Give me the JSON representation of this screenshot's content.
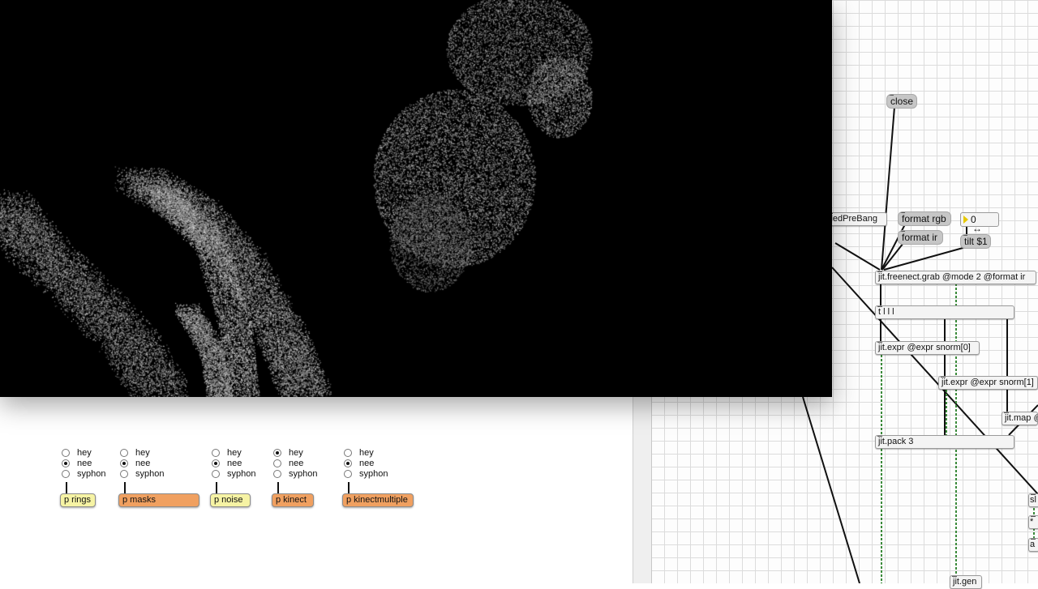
{
  "colors": {
    "yellow_subpatcher": "#f6f3a4",
    "orange_subpatcher": "#f0a060",
    "patch_cord": "#111111",
    "signal_cord": "#3a8a3a"
  },
  "radio_groups": [
    {
      "id": "rings",
      "options": [
        "hey",
        "nee",
        "syphon"
      ],
      "selected": 1
    },
    {
      "id": "masks",
      "options": [
        "hey",
        "nee",
        "syphon"
      ],
      "selected": 1
    },
    {
      "id": "noise",
      "options": [
        "hey",
        "nee",
        "syphon"
      ],
      "selected": 1
    },
    {
      "id": "kinect",
      "options": [
        "hey",
        "nee",
        "syphon"
      ],
      "selected": 0
    },
    {
      "id": "kinectmultiple",
      "options": [
        "hey",
        "nee",
        "syphon"
      ],
      "selected": 1
    }
  ],
  "subpatchers": [
    {
      "label": "p rings",
      "color": "yellow"
    },
    {
      "label": "p masks",
      "color": "orange"
    },
    {
      "label": "p noise",
      "color": "yellow"
    },
    {
      "label": "p kinect",
      "color": "orange"
    },
    {
      "label": "p kinectmultiple",
      "color": "orange"
    }
  ],
  "patcher": {
    "close_msg": "close",
    "prebang_obj": "lledPreBang",
    "format_rgb_msg": "format rgb",
    "format_ir_msg": "format ir",
    "tilt_number": "0",
    "tilt_msg": "tilt $1",
    "freenect_obj": "jit.freenect.grab @mode 2 @format ir",
    "trigger_obj": "t l l l",
    "expr0_obj": "jit.expr @expr snorm[0]",
    "expr1_obj": "jit.expr @expr snorm[1]",
    "map_obj": "jit.map @",
    "pack_obj": "jit.pack 3",
    "gen_obj": "jit.gen",
    "edge_obj_a": "sl",
    "edge_obj_b": "*",
    "edge_obj_c": "a"
  }
}
